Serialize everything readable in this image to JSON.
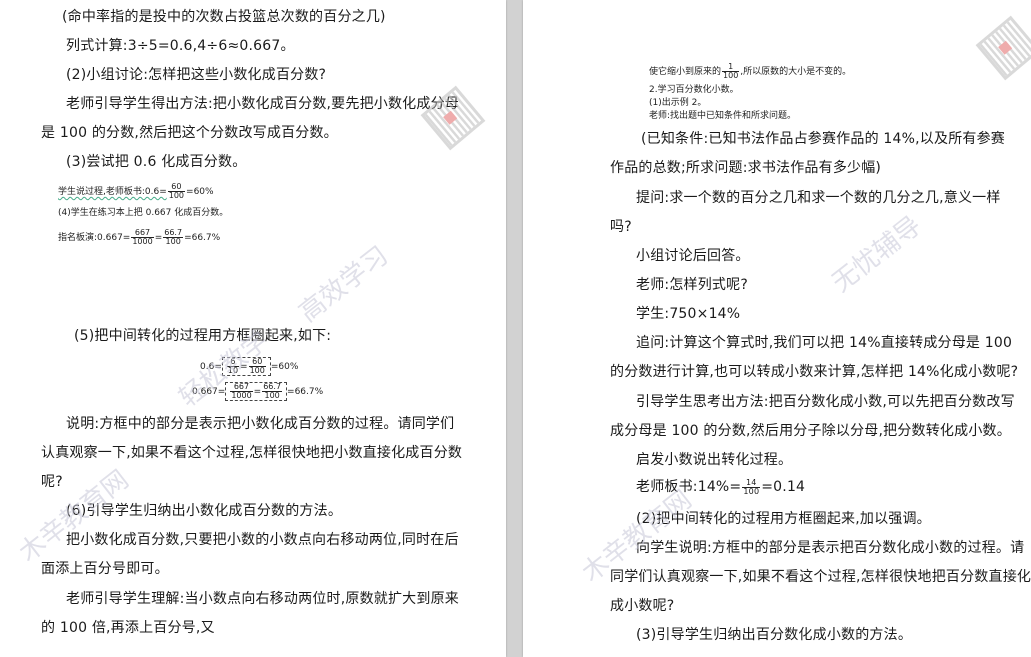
{
  "left": {
    "l1": "(命中率指的是投中的次数占投篮总次数的百分之几)",
    "l2": "列式计算:3÷5=0.6,4÷6≈0.667。",
    "l3": "(2)小组讨论:怎样把这些小数化成百分数?",
    "l4": "老师引导学生得出方法:把小数化成百分数,要先把小数化成分母",
    "l5": "是 100 的分数,然后把这个分数改写成百分数。",
    "l6": "(3)尝试把 0.6 化成百分数。",
    "s1a": "学生说过程,老师板书:0.6=",
    "s1n": "60",
    "s1d": "100",
    "s1b": "=60%",
    "s2": "(4)学生在练习本上把 0.667 化成百分数。",
    "s3a": "指名板演:0.667=",
    "s3n1": "667",
    "s3d1": "1000",
    "s3eq": "=",
    "s3n2": "66.7",
    "s3d2": "100",
    "s3b": "=66.7%",
    "l7": "(5)把中间转化的过程用方框圈起来,如下:",
    "b1a": "0.6=",
    "b1n1": "6",
    "b1d1": "10",
    "b1eq": "=",
    "b1n2": "60",
    "b1d2": "100",
    "b1b": "=60%",
    "b2a": "0.667=",
    "b2n1": "667",
    "b2d1": "1000",
    "b2eq": "=",
    "b2n2": "66.7",
    "b2d2": "100",
    "b2b": "=66.7%",
    "l8": "说明:方框中的部分是表示把小数化成百分数的过程。请同学们",
    "l9": "认真观察一下,如果不看这个过程,怎样很快地把小数直接化成百分数",
    "l10": "呢?",
    "l11": "(6)引导学生归纳出小数化成百分数的方法。",
    "l12": "把小数化成百分数,只要把小数的小数点向右移动两位,同时在后",
    "l13": "面添上百分号即可。",
    "l14": "老师引导学生理解:当小数点向右移动两位时,原数就扩大到原来",
    "l15": "的 100 倍,再添上百分号,又"
  },
  "right": {
    "s1a": "使它缩小到原来的",
    "s1n": "1",
    "s1d": "100",
    "s1b": ",所以原数的大小是不变的。",
    "s2": "2.学习百分数化小数。",
    "s3": "(1)出示例 2。",
    "s4": "老师:找出题中已知条件和所求问题。",
    "l1": "(已知条件:已知书法作品占参赛作品的 14%,以及所有参赛",
    "l2": "作品的总数;所求问题:求书法作品有多少幅)",
    "l3": "提问:求一个数的百分之几和求一个数的几分之几,意义一样",
    "l4": "吗?",
    "l5": "小组讨论后回答。",
    "l6": "老师:怎样列式呢?",
    "l7": "学生:750×14%",
    "l8": "追问:计算这个算式时,我们可以把 14%直接转成分母是 100",
    "l9": "的分数进行计算,也可以转成小数来计算,怎样把 14%化成小数呢?",
    "l10": "引导学生思考出方法:把百分数化成小数,可以先把百分数改写",
    "l11": "成分母是 100 的分数,然后用分子除以分母,把分数转化成小数。",
    "l12": "启发小数说出转化过程。",
    "l13a": "老师板书:14%=",
    "l13n": "14",
    "l13d": "100",
    "l13b": "=0.14",
    "l14": "(2)把中间转化的过程用方框圈起来,加以强调。",
    "l15": "向学生说明:方框中的部分是表示把百分数化成小数的过程。请",
    "l16": "同学们认真观察一下,如果不看这个过程,怎样很快地把百分数直接化",
    "l17": "成小数呢?",
    "l18": "(3)引导学生归纳出百分数化成小数的方法。"
  },
  "watermarks": {
    "w1": "木辛教育网",
    "w2": "轻松教学",
    "w3": "高效学习",
    "w4": "无忧辅导",
    "w5": "木辛教育网"
  },
  "colors": {
    "page": "#ffffff",
    "gutter": "#d2d2d2",
    "text": "#1a1a1a",
    "watermark": "#c8c8d8"
  }
}
